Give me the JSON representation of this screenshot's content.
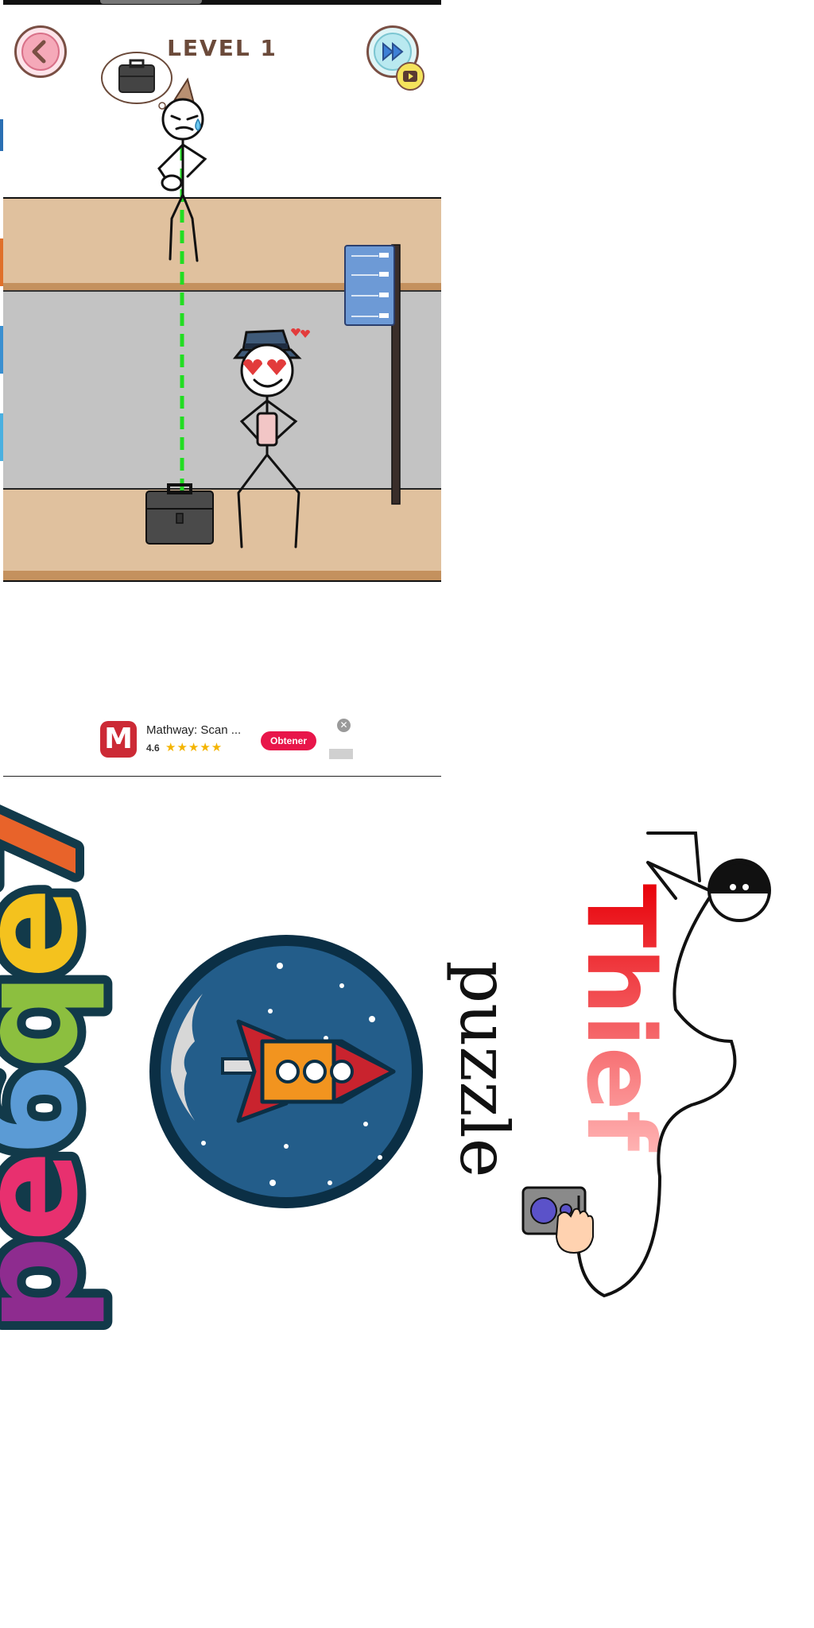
{
  "level": {
    "title": "LEVEL 1"
  },
  "ad": {
    "app_name": "Mathway: Scan ...",
    "logo_letter": "M",
    "rating": "4.6",
    "stars": "★★★★★",
    "cta_label": "Obtener",
    "close_symbol": "✕"
  },
  "logos": {
    "thief_word": "Thief",
    "puzzle_word": "puzzle"
  },
  "colors": {
    "accent_pink": "#e8164a",
    "floor_tan": "#e0c19e",
    "road_gray": "#c3c3c3",
    "guide_line": "#22dd22"
  }
}
